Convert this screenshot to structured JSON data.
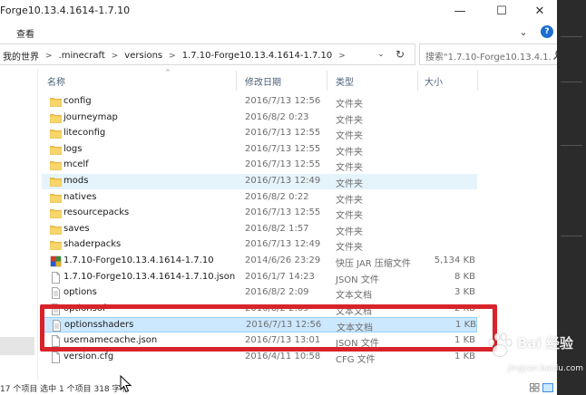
{
  "window": {
    "title": "Forge10.13.4.1614-1.7.10",
    "minimize_glyph": "—",
    "maximize_glyph": "☐",
    "close_glyph": "✕"
  },
  "ribbon": {
    "view_tab": "查看",
    "expand_glyph": "⌄",
    "help_glyph": "?"
  },
  "address": {
    "crumbs": [
      "我的世界",
      ".minecraft",
      "versions",
      "1.7.10-Forge10.13.4.1614-1.7.10"
    ],
    "separator": ">",
    "dropdown_glyph": "⌄",
    "refresh_glyph": "↻"
  },
  "search": {
    "placeholder": "搜索\"1.7.10-Forge10.13.4.1...",
    "icon": "search-icon"
  },
  "columns": {
    "name": "名称",
    "modified": "修改日期",
    "type": "类型",
    "size": "大小",
    "sort_glyph": "^"
  },
  "files": [
    {
      "name": "config",
      "date": "2016/7/13 12:56",
      "type": "文件夹",
      "size": "",
      "icon": "folder"
    },
    {
      "name": "journeymap",
      "date": "2016/8/2 0:23",
      "type": "文件夹",
      "size": "",
      "icon": "folder"
    },
    {
      "name": "liteconfig",
      "date": "2016/7/13 12:55",
      "type": "文件夹",
      "size": "",
      "icon": "folder"
    },
    {
      "name": "logs",
      "date": "2016/7/13 12:55",
      "type": "文件夹",
      "size": "",
      "icon": "folder"
    },
    {
      "name": "mcelf",
      "date": "2016/7/13 12:55",
      "type": "文件夹",
      "size": "",
      "icon": "folder"
    },
    {
      "name": "mods",
      "date": "2016/7/13 12:49",
      "type": "文件夹",
      "size": "",
      "icon": "folder",
      "state": "hover"
    },
    {
      "name": "natives",
      "date": "2016/8/2 0:22",
      "type": "文件夹",
      "size": "",
      "icon": "folder"
    },
    {
      "name": "resourcepacks",
      "date": "2016/7/13 12:55",
      "type": "文件夹",
      "size": "",
      "icon": "folder"
    },
    {
      "name": "saves",
      "date": "2016/8/2 1:57",
      "type": "文件夹",
      "size": "",
      "icon": "folder"
    },
    {
      "name": "shaderpacks",
      "date": "2016/7/13 12:49",
      "type": "文件夹",
      "size": "",
      "icon": "folder"
    },
    {
      "name": "1.7.10-Forge10.13.4.1614-1.7.10",
      "date": "2014/6/26 23:29",
      "type": "快压 JAR 压缩文件",
      "size": "5,134 KB",
      "icon": "jar"
    },
    {
      "name": "1.7.10-Forge10.13.4.1614-1.7.10.json",
      "date": "2016/1/7 14:23",
      "type": "JSON 文件",
      "size": "8 KB",
      "icon": "file"
    },
    {
      "name": "options",
      "date": "2016/8/2 2:09",
      "type": "文本文档",
      "size": "3 KB",
      "icon": "text"
    },
    {
      "name": "optionsof",
      "date": "2016/8/2 2:09",
      "type": "文本文档",
      "size": "2 KB",
      "icon": "text"
    },
    {
      "name": "optionsshaders",
      "date": "2016/7/13 12:56",
      "type": "文本文档",
      "size": "1 KB",
      "icon": "text",
      "state": "selected"
    },
    {
      "name": "usernamecache.json",
      "date": "2016/7/13 13:01",
      "type": "JSON 文件",
      "size": "1 KB",
      "icon": "file"
    },
    {
      "name": "version.cfg",
      "date": "2016/4/11 10:58",
      "type": "CFG 文件",
      "size": "1 KB",
      "icon": "file"
    }
  ],
  "status": {
    "text": "17 个项目   选中 1 个项目  318 字节"
  },
  "watermark": {
    "brand": "Bai 经验",
    "url": "jingyan.baidu.com"
  },
  "colors": {
    "hover": "#e5f3fb",
    "selected": "#cce8ff",
    "highlight_box": "#d8232a",
    "folder": "#f3c84a",
    "column_header_text": "#4c607a"
  }
}
